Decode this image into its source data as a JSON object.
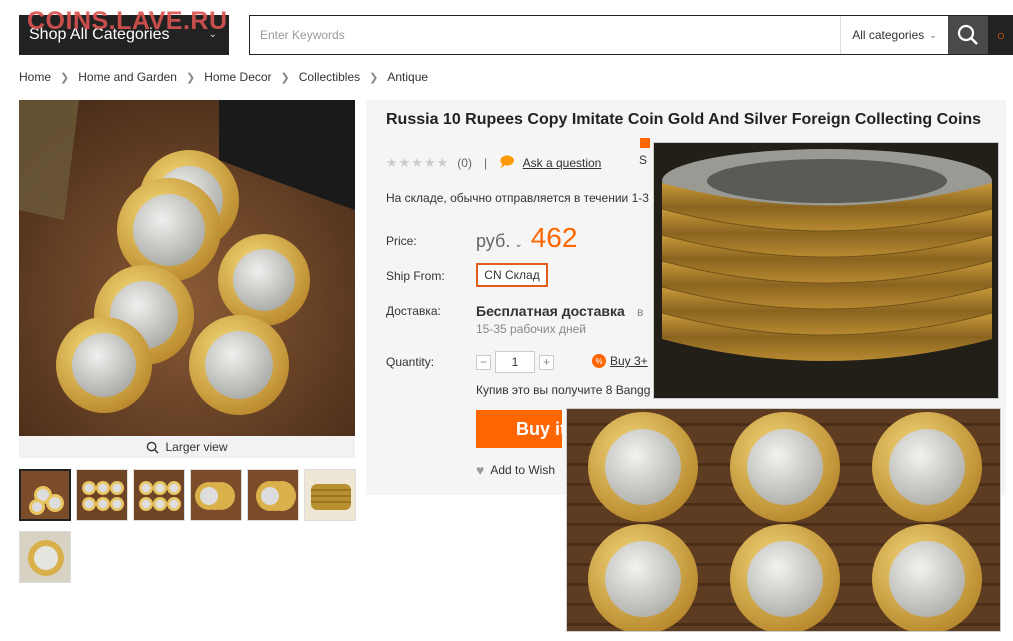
{
  "watermark": "COINS.LAVE.RU",
  "header": {
    "categories_label": "Shop All Categories",
    "search_placeholder": "Enter Keywords",
    "search_category": "All categories"
  },
  "breadcrumb": [
    "Home",
    "Home and Garden",
    "Home Decor",
    "Collectibles",
    "Antique"
  ],
  "gallery": {
    "larger_view": "Larger view",
    "thumbnail_count": 7
  },
  "product": {
    "title": "Russia 10 Rupees Copy Imitate Coin Gold And Silver Foreign Collecting Coins",
    "stars": "★★★★★",
    "review_count": "(0)",
    "separator": "|",
    "ask_question": "Ask a question",
    "truncated_letter": "S",
    "stock_text": "На складе, обычно отправляется в течении 1-3",
    "price_label": "Price:",
    "currency": "руб.",
    "price_value": "462",
    "ship_from_label": "Ship From:",
    "ship_from_value": "CN Склад",
    "delivery_label": "Доставка:",
    "delivery_value": "Бесплатная доставка",
    "delivery_in": "в",
    "delivery_days": "15-35 рабочих дней",
    "quantity_label": "Quantity:",
    "quantity_value": "1",
    "minus": "−",
    "plus": "+",
    "bulk_badge": "%",
    "bulk_link": "Buy 3+",
    "points_text": "Купив это вы получите 8 Bangg",
    "buy_label": "Buy it",
    "wishlist_label": "Add to Wish"
  },
  "colors": {
    "accent": "#ff6600",
    "header_dark": "#222222",
    "panel_bg": "#f5f5f5"
  }
}
